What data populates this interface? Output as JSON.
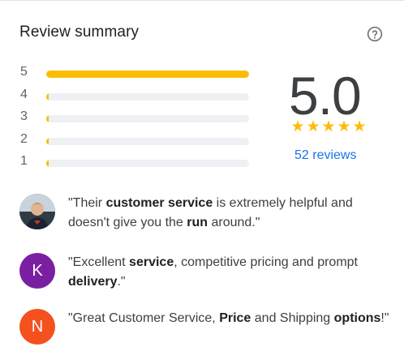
{
  "header": {
    "title": "Review summary",
    "help_icon": "help-circle-icon"
  },
  "distribution": [
    {
      "stars": "5",
      "fraction": 1.0
    },
    {
      "stars": "4",
      "fraction": 0.0
    },
    {
      "stars": "3",
      "fraction": 0.0
    },
    {
      "stars": "2",
      "fraction": 0.0
    },
    {
      "stars": "1",
      "fraction": 0.0
    }
  ],
  "rating": {
    "score": "5.0",
    "stars": 5,
    "reviews_label": "52 reviews"
  },
  "snippets": [
    {
      "avatar": "photo",
      "avatar_color": "#3b4a5a",
      "parts": [
        {
          "t": "\"Their ",
          "b": false
        },
        {
          "t": "customer service",
          "b": true
        },
        {
          "t": " is extremely helpful and doesn't give you the ",
          "b": false
        },
        {
          "t": "run",
          "b": true
        },
        {
          "t": " around.\"",
          "b": false
        }
      ]
    },
    {
      "avatar": "K",
      "avatar_color": "#7b1fa2",
      "parts": [
        {
          "t": "\"Excellent ",
          "b": false
        },
        {
          "t": "service",
          "b": true
        },
        {
          "t": ", competitive pricing and prompt ",
          "b": false
        },
        {
          "t": "delivery",
          "b": true
        },
        {
          "t": ".\"",
          "b": false
        }
      ]
    },
    {
      "avatar": "N",
      "avatar_color": "#f4511e",
      "parts": [
        {
          "t": "\"Great Customer Service, ",
          "b": false
        },
        {
          "t": "Price",
          "b": true
        },
        {
          "t": " and Shipping ",
          "b": false
        },
        {
          "t": "options",
          "b": true
        },
        {
          "t": "!\"",
          "b": false
        }
      ]
    }
  ]
}
